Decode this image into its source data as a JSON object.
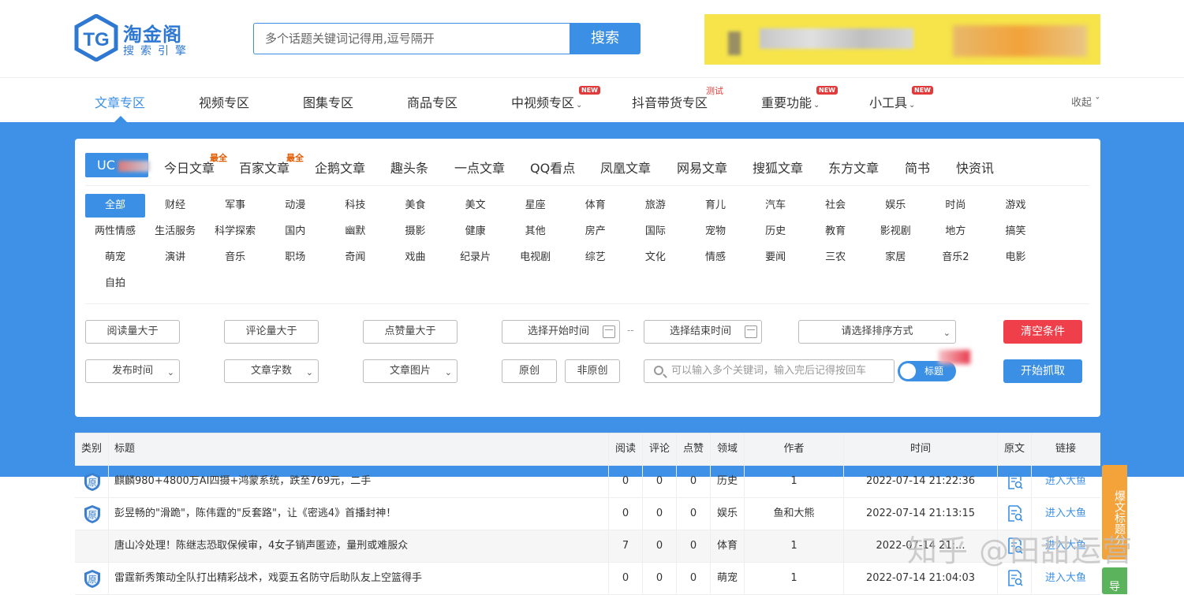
{
  "header": {
    "logo_title": "淘金阁",
    "logo_sub": "搜索引擎",
    "search_placeholder": "多个话题关键词记得用,逗号隔开",
    "search_button": "搜索"
  },
  "nav": {
    "items": [
      {
        "label": "文章专区"
      },
      {
        "label": "视频专区"
      },
      {
        "label": "图集专区"
      },
      {
        "label": "商品专区"
      },
      {
        "label": "中视频专区",
        "badge": "NEW"
      },
      {
        "label": "抖音带货专区",
        "badge": "测试"
      },
      {
        "label": "重要功能",
        "badge": "NEW"
      },
      {
        "label": "小工具",
        "badge": "NEW"
      }
    ],
    "collapse": "收起"
  },
  "sources": {
    "items": [
      "UC",
      "今日文章",
      "百家文章",
      "企鹅文章",
      "趣头条",
      "一点文章",
      "QQ看点",
      "凤凰文章",
      "网易文章",
      "搜狐文章",
      "东方文章",
      "简书",
      "快资讯"
    ],
    "badge_all": "最全"
  },
  "categories": [
    "全部",
    "财经",
    "军事",
    "动漫",
    "科技",
    "美食",
    "美文",
    "星座",
    "体育",
    "旅游",
    "育儿",
    "汽车",
    "社会",
    "娱乐",
    "时尚",
    "游戏",
    "两性情感",
    "生活服务",
    "科学探索",
    "国内",
    "幽默",
    "摄影",
    "健康",
    "其他",
    "房产",
    "国际",
    "宠物",
    "历史",
    "教育",
    "影视剧",
    "地方",
    "搞笑",
    "萌宠",
    "演讲",
    "音乐",
    "职场",
    "奇闻",
    "戏曲",
    "纪录片",
    "电视剧",
    "综艺",
    "文化",
    "情感",
    "要闻",
    "三农",
    "家居",
    "音乐2",
    "电影",
    "自拍"
  ],
  "filters": {
    "read_gt": "阅读量大于",
    "comment_gt": "评论量大于",
    "like_gt": "点赞量大于",
    "start_time": "选择开始时间",
    "range_sep": "--",
    "end_time": "选择结束时间",
    "sort": "请选择排序方式",
    "clear": "清空条件",
    "publish_time": "发布时间",
    "word_count": "文章字数",
    "images": "文章图片",
    "original": "原创",
    "non_original": "非原创",
    "keyword_placeholder": "可以输入多个关键词，输入完后记得按回车",
    "toggle_label": "标题",
    "fetch": "开始抓取"
  },
  "table": {
    "headers": {
      "type": "类别",
      "title": "标题",
      "read": "阅读",
      "comment": "评论",
      "like": "点赞",
      "field": "领域",
      "author": "作者",
      "time": "时间",
      "source": "原文",
      "link": "链接"
    },
    "type_badge": "原",
    "rows": [
      {
        "original": true,
        "title": "麒麟980+4800万AI四摄+鸿蒙系统，跌至769元，二手",
        "read": "0",
        "comment": "0",
        "like": "0",
        "field": "历史",
        "author": "1",
        "time": "2022-07-14 21:22:36",
        "link": "进入大鱼"
      },
      {
        "original": true,
        "title": "彭昱畅的\"滑跪\"，陈伟霆的\"反套路\"，让《密逃4》首播封神！",
        "read": "0",
        "comment": "0",
        "like": "0",
        "field": "娱乐",
        "author": "鱼和大熊",
        "time": "2022-07-14 21:13:15",
        "link": "进入大鱼"
      },
      {
        "original": false,
        "title": "唐山冷处理！陈继志恐取保候审，4女子销声匿迹，量刑或难服众",
        "read": "7",
        "comment": "0",
        "like": "0",
        "field": "体育",
        "author": "1",
        "time": "2022-07-14 21:...",
        "link": "进入大鱼"
      },
      {
        "original": true,
        "title": "雷霆新秀策动全队打出精彩战术，戏耍五名防守后助队友上空篮得手",
        "read": "0",
        "comment": "0",
        "like": "0",
        "field": "萌宠",
        "author": "1",
        "time": "2022-07-14 21:04:03",
        "link": "进入大鱼"
      }
    ]
  },
  "side": {
    "orange": "爆文标题分",
    "green": "导"
  },
  "watermark": "知乎 @田甜运营",
  "colors": {
    "accent": "#3b8fe4",
    "danger": "#ef3f4a",
    "band": "#3e91e6"
  }
}
